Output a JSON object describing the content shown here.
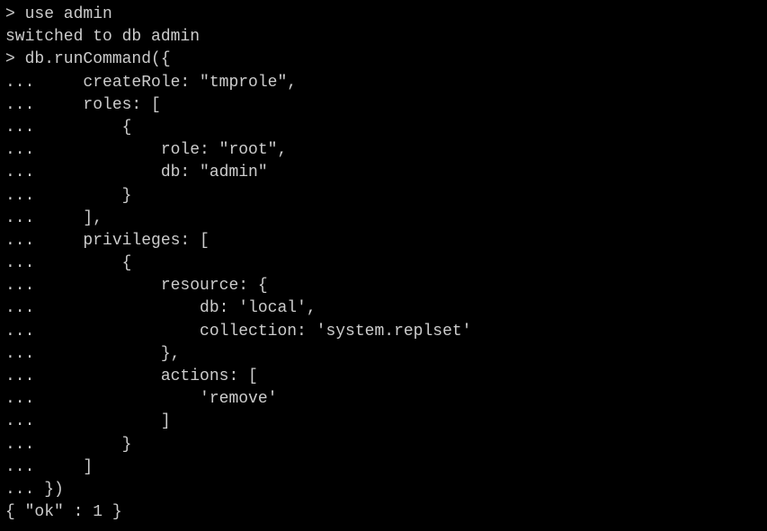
{
  "terminal": {
    "lines": [
      "> use admin",
      "switched to db admin",
      "> db.runCommand({",
      "...     createRole: \"tmprole\",",
      "...     roles: [",
      "...         {",
      "...             role: \"root\",",
      "...             db: \"admin\"",
      "...         }",
      "...     ],",
      "...     privileges: [",
      "...         {",
      "...             resource: {",
      "...                 db: 'local',",
      "...                 collection: 'system.replset'",
      "...             },",
      "...             actions: [",
      "...                 'remove'",
      "...             ]",
      "...         }",
      "...     ]",
      "... })",
      "{ \"ok\" : 1 }"
    ]
  }
}
